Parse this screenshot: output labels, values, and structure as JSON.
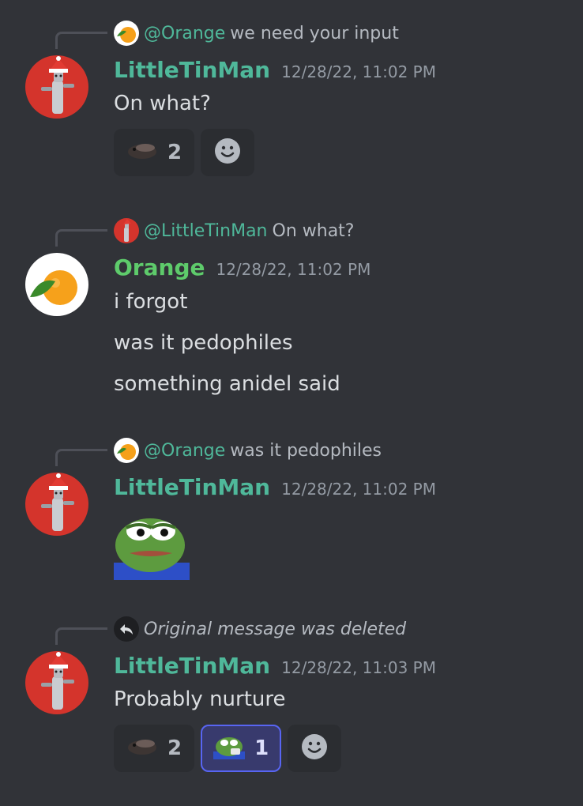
{
  "colors": {
    "background": "#313338",
    "littletinman_name": "#4fb89a",
    "orange_name": "#5ecb6b",
    "mention": "#4fb89a",
    "active_reaction_border": "#5865f2"
  },
  "messages": [
    {
      "reply": {
        "avatar_icon": "orange-fruit-icon",
        "mention": "@Orange",
        "text": "we need your input"
      },
      "author": "LittleTinMan",
      "avatar_icon": "tin-man-santa-avatar",
      "timestamp": "12/28/22, 11:02 PM",
      "lines": [
        "On what?"
      ],
      "reactions": [
        {
          "emoji_icon": "fish-emoji-icon",
          "count": "2",
          "active": false
        }
      ]
    },
    {
      "reply": {
        "avatar_icon": "tin-man-santa-avatar",
        "mention": "@LittleTinMan",
        "text": "On what?"
      },
      "author": "Orange",
      "avatar_icon": "orange-fruit-avatar",
      "timestamp": "12/28/22, 11:02 PM",
      "lines": [
        "i forgot",
        "was it pedophiles",
        "something anidel said"
      ]
    },
    {
      "reply": {
        "avatar_icon": "orange-fruit-icon",
        "mention": "@Orange",
        "text": "was it pedophiles"
      },
      "author": "LittleTinMan",
      "avatar_icon": "tin-man-santa-avatar",
      "timestamp": "12/28/22, 11:02 PM",
      "sticker_icon": "pepe-frog-sticker"
    },
    {
      "reply": {
        "avatar_icon": "reply-arrow-icon",
        "deleted_text": "Original message was deleted"
      },
      "author": "LittleTinMan",
      "avatar_icon": "tin-man-santa-avatar",
      "timestamp": "12/28/22, 11:03 PM",
      "lines": [
        "Probably nurture"
      ],
      "reactions": [
        {
          "emoji_icon": "fish-emoji-icon",
          "count": "2",
          "active": false
        },
        {
          "emoji_icon": "pepe-emoji-icon",
          "count": "1",
          "active": true
        }
      ]
    }
  ]
}
